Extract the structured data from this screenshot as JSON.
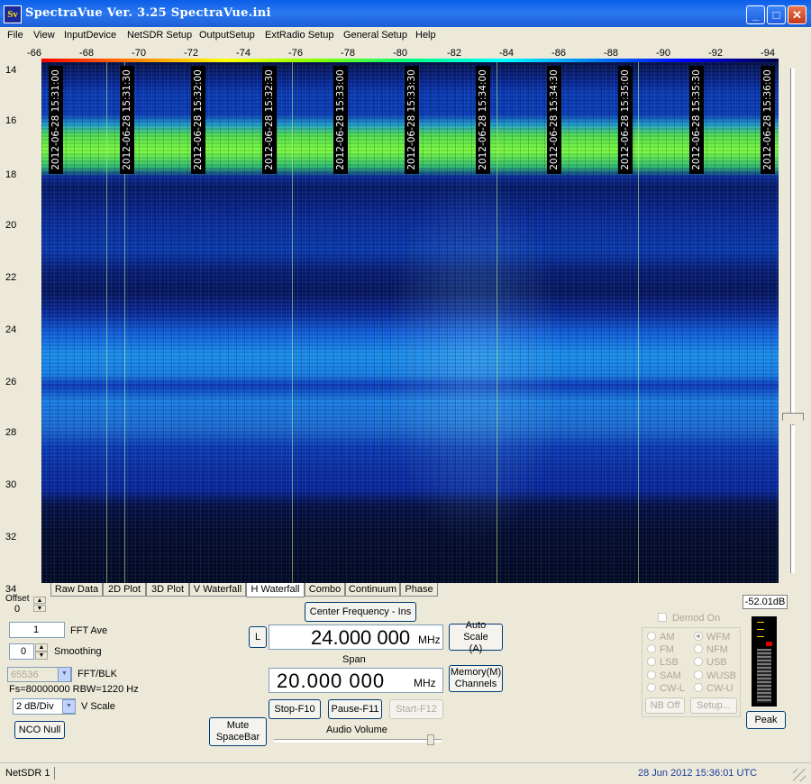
{
  "window": {
    "title": "SpectraVue Ver. 3.25  SpectraVue.ini",
    "icon_text": "Sv",
    "minimize": "_",
    "maximize": "□",
    "close": "✕"
  },
  "menu": [
    "File",
    "View",
    "InputDevice",
    "NetSDR Setup",
    "OutputSetup",
    "ExtRadio Setup",
    "General Setup",
    "Help"
  ],
  "top_scale": [
    "-66",
    "-68",
    "-70",
    "-72",
    "-74",
    "-76",
    "-78",
    "-80",
    "-82",
    "-84",
    "-86",
    "-88",
    "-90",
    "-92",
    "-94"
  ],
  "left_scale": [
    "14",
    "16",
    "18",
    "20",
    "22",
    "24",
    "26",
    "28",
    "30",
    "32",
    "34"
  ],
  "timestamps": [
    "2012-06-28 15:31:00",
    "2012-06-28 15:31:30",
    "2012-06-28 15:32:00",
    "2012-06-28 15:32:30",
    "2012-06-28 15:33:00",
    "2012-06-28 15:33:30",
    "2012-06-28 15:34:00",
    "2012-06-28 15:34:30",
    "2012-06-28 15:35:00",
    "2012-06-28 15:35:30",
    "2012-06-28 15:36:00"
  ],
  "tabs": [
    "Raw Data",
    "2D Plot",
    "3D Plot",
    "V Waterfall",
    "H Waterfall",
    "Combo",
    "Continuum",
    "Phase"
  ],
  "active_tab": "H Waterfall",
  "controls": {
    "offset_label": "Offset",
    "offset_value": "0",
    "fft_ave_value": "1",
    "fft_ave_label": "FFT Ave",
    "smoothing_value": "0",
    "smoothing_label": "Smoothing",
    "fft_blk_value": "65536",
    "fft_blk_label": "FFT/BLK",
    "fs_rbw": "Fs=80000000 RBW=1220 Hz",
    "vscale_value": "2 dB/Div",
    "vscale_label": "V Scale",
    "nco_null": "NCO Null",
    "mute": "Mute SpaceBar",
    "center_freq_button": "Center Frequency - Ins",
    "l_button": "L",
    "center_freq_value": "24.000 000",
    "center_freq_unit": "MHz",
    "auto_scale": "Auto Scale (A)",
    "span_label": "Span",
    "span_value": "20.000 000",
    "span_unit": "MHz",
    "memory_channels": "Memory(M) Channels",
    "stop": "Stop-F10",
    "pause": "Pause-F11",
    "start": "Start-F12",
    "audio_volume": "Audio Volume"
  },
  "demod": {
    "title": "Demod On",
    "modes": [
      {
        "label": "AM",
        "selected": false
      },
      {
        "label": "WFM",
        "selected": true
      },
      {
        "label": "FM",
        "selected": false
      },
      {
        "label": "NFM",
        "selected": false
      },
      {
        "label": "LSB",
        "selected": false
      },
      {
        "label": "USB",
        "selected": false
      },
      {
        "label": "SAM",
        "selected": false
      },
      {
        "label": "WUSB",
        "selected": false
      },
      {
        "label": "CW-L",
        "selected": false
      },
      {
        "label": "CW-U",
        "selected": false
      }
    ],
    "nb_off": "NB Off",
    "setup": "Setup..."
  },
  "meter": {
    "reading": "-52.01dB",
    "peak": "Peak"
  },
  "status": {
    "left": "NetSDR 1",
    "right": "28 Jun 2012   15:36:01 UTC"
  }
}
